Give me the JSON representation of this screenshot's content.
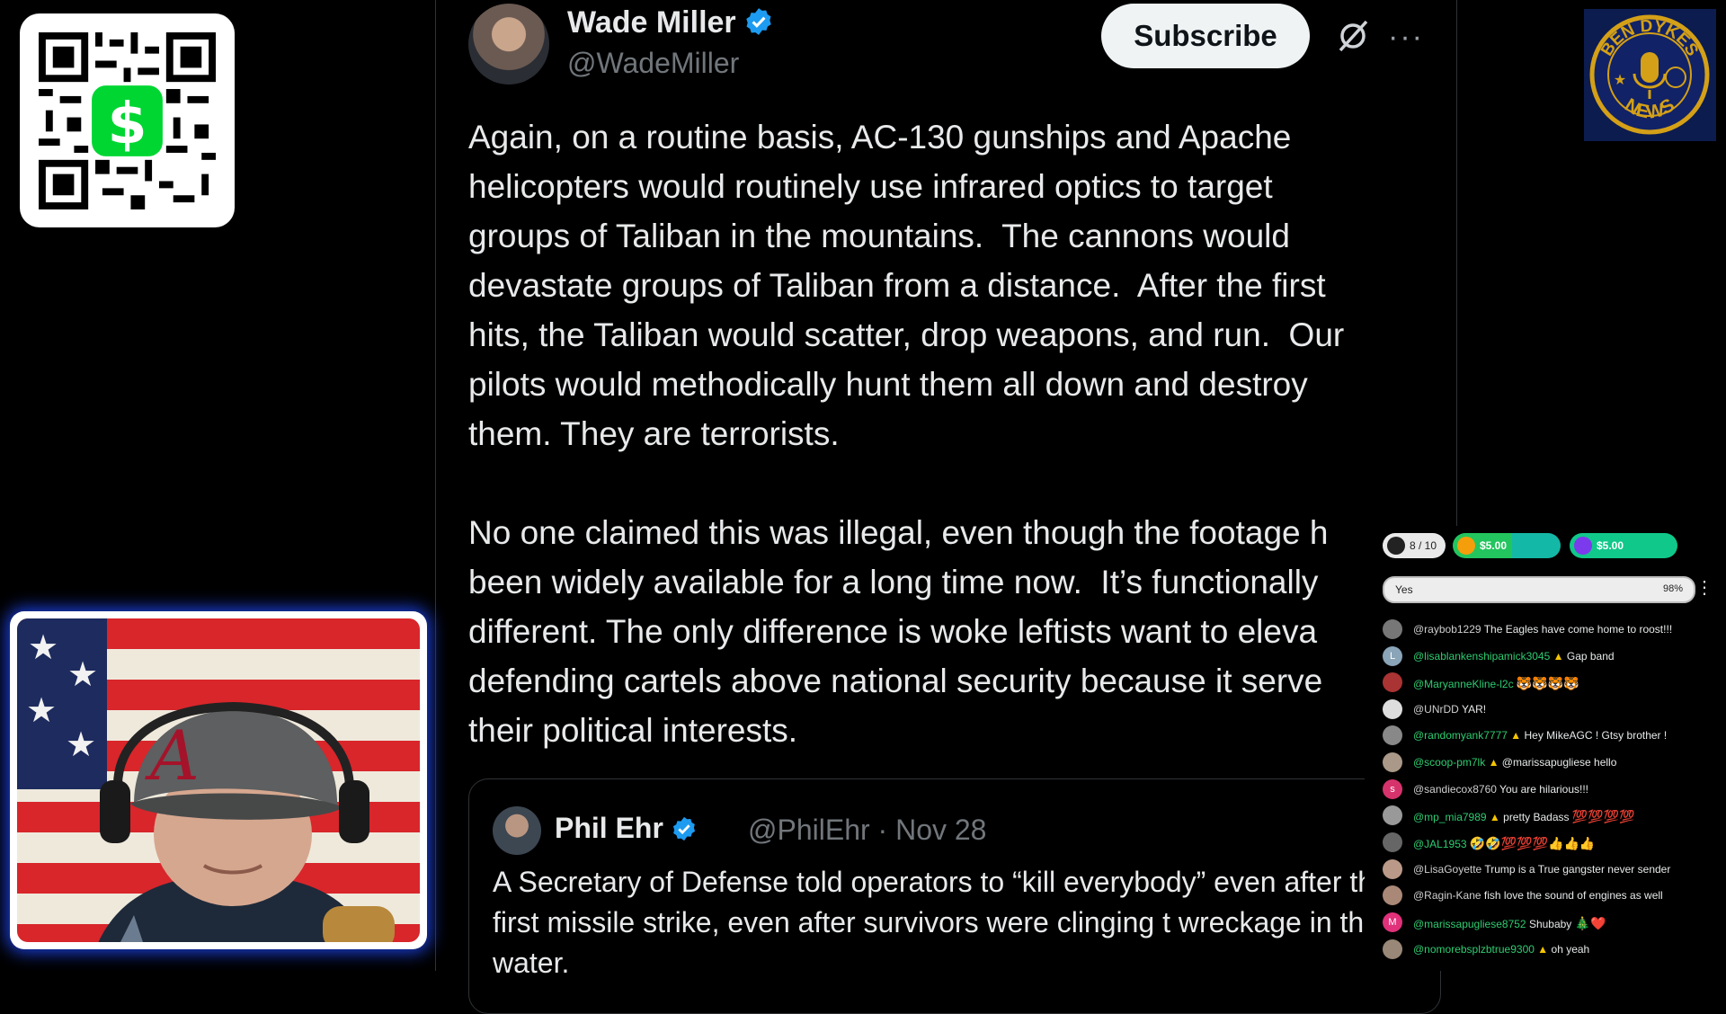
{
  "tweet": {
    "author_name": "Wade Miller",
    "author_handle": "@WadeMiller",
    "subscribe_label": "Subscribe",
    "more_label": "···",
    "paragraph1": "Again, on a routine basis, AC-130 gunships and Apache\nhelicopters would routinely use infrared optics to target\ngroups of Taliban in the mountains.  The cannons would\ndevastate groups of Taliban from a distance.  After the first\nhits, the Taliban would scatter, drop weapons, and run.  Our\npilots would methodically hunt them all down and destroy\nthem. They are terrorists.",
    "paragraph2": "No one claimed this was illegal, even though the footage h\nbeen widely available for a long time now.  It’s functionally\ndifferent. The only difference is woke leftists want to eleva\ndefending cartels above national security because it serve\ntheir political interests.",
    "quote": {
      "author_name": "Phil Ehr",
      "meta": "@PhilEhr · Nov 28",
      "text": "A Secretary of Defense told operators to “kill everybody” even after the first missile strike, even after survivors were clinging t wreckage in the water."
    }
  },
  "brand": {
    "top_text": "BEN DYKES",
    "bottom_text": "NEWS"
  },
  "chat": {
    "goal_label": "8 / 10",
    "donation1": "$5.00",
    "donation2": "$5.00",
    "poll_option": "Yes",
    "poll_percent": "98%",
    "messages": [
      {
        "user": "@raybob1229",
        "text": "The Eagles have come home to roost!!!",
        "color": "#cfcfcf"
      },
      {
        "user": "@lisablankenshipamick3045",
        "text": "Gap band",
        "color": "#2ecc71"
      },
      {
        "user": "@MaryanneKline-l2c",
        "text": "",
        "color": "#2ecc71"
      },
      {
        "user": "@UNrDD",
        "text": "YAR!",
        "color": "#cfcfcf"
      },
      {
        "user": "@randomyank7777",
        "text": "Hey MikeAGC ! Gtsy brother !",
        "color": "#2ecc71"
      },
      {
        "user": "@scoop-pm7lk",
        "text": "@marissapugliese hello",
        "color": "#2ecc71"
      },
      {
        "user": "@sandiecox8760",
        "text": "You are hilarious!!!",
        "color": "#cfcfcf"
      },
      {
        "user": "@mp_mia7989",
        "text": "pretty Badass",
        "color": "#2ecc71"
      },
      {
        "user": "@JAL1953",
        "text": "",
        "color": "#2ecc71"
      },
      {
        "user": "@LisaGoyette",
        "text": "Trump is a True gangster never sender",
        "color": "#cfcfcf"
      },
      {
        "user": "@Ragin-Kane",
        "text": "fish love the sound of engines as well",
        "color": "#cfcfcf"
      },
      {
        "user": "@marissapugliese8752",
        "text": "Shubaby",
        "color": "#2ecc71"
      },
      {
        "user": "@nomorebsplzbtrue9300",
        "text": "oh yeah",
        "color": "#2ecc71"
      }
    ]
  },
  "colors": {
    "accent_blue": "#1d9bf0",
    "cam_glow": "#1b3fd8",
    "chat_green": "#2ecc71"
  }
}
